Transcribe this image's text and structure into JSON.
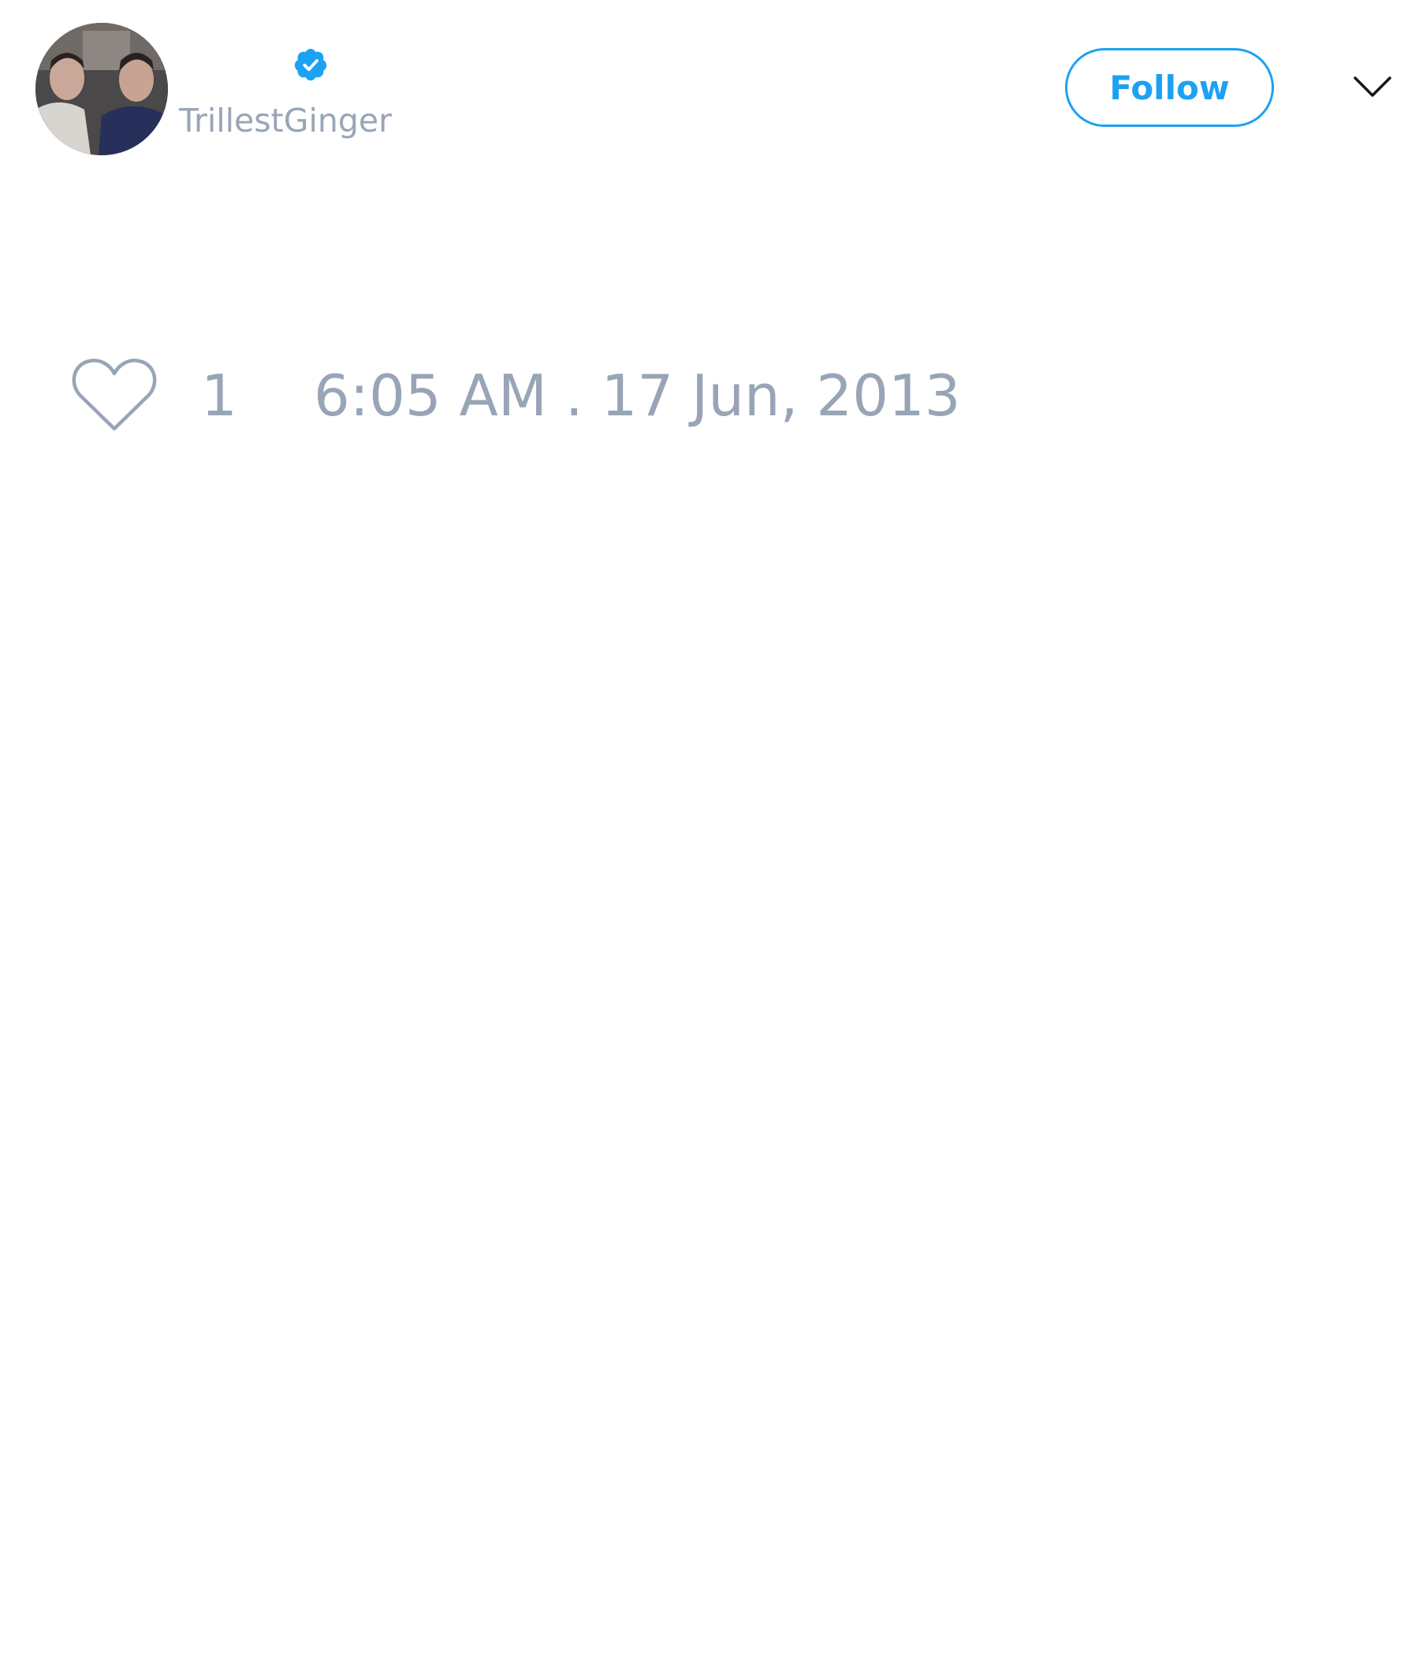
{
  "tweet": {
    "author": {
      "username": "TrillestGinger",
      "verified": true,
      "avatar_icon": "profile-photo-icon",
      "badge_icon": "verified-badge-icon"
    },
    "follow_label": "Follow",
    "menu_icon": "chevron-down-icon",
    "likes": {
      "icon": "heart-icon",
      "count": "1"
    },
    "timestamp": "6:05 AM . 17 Jun, 2013"
  },
  "colors": {
    "accent": "#1da1f2",
    "muted_text": "#98a5b6",
    "background": "#ffffff"
  }
}
